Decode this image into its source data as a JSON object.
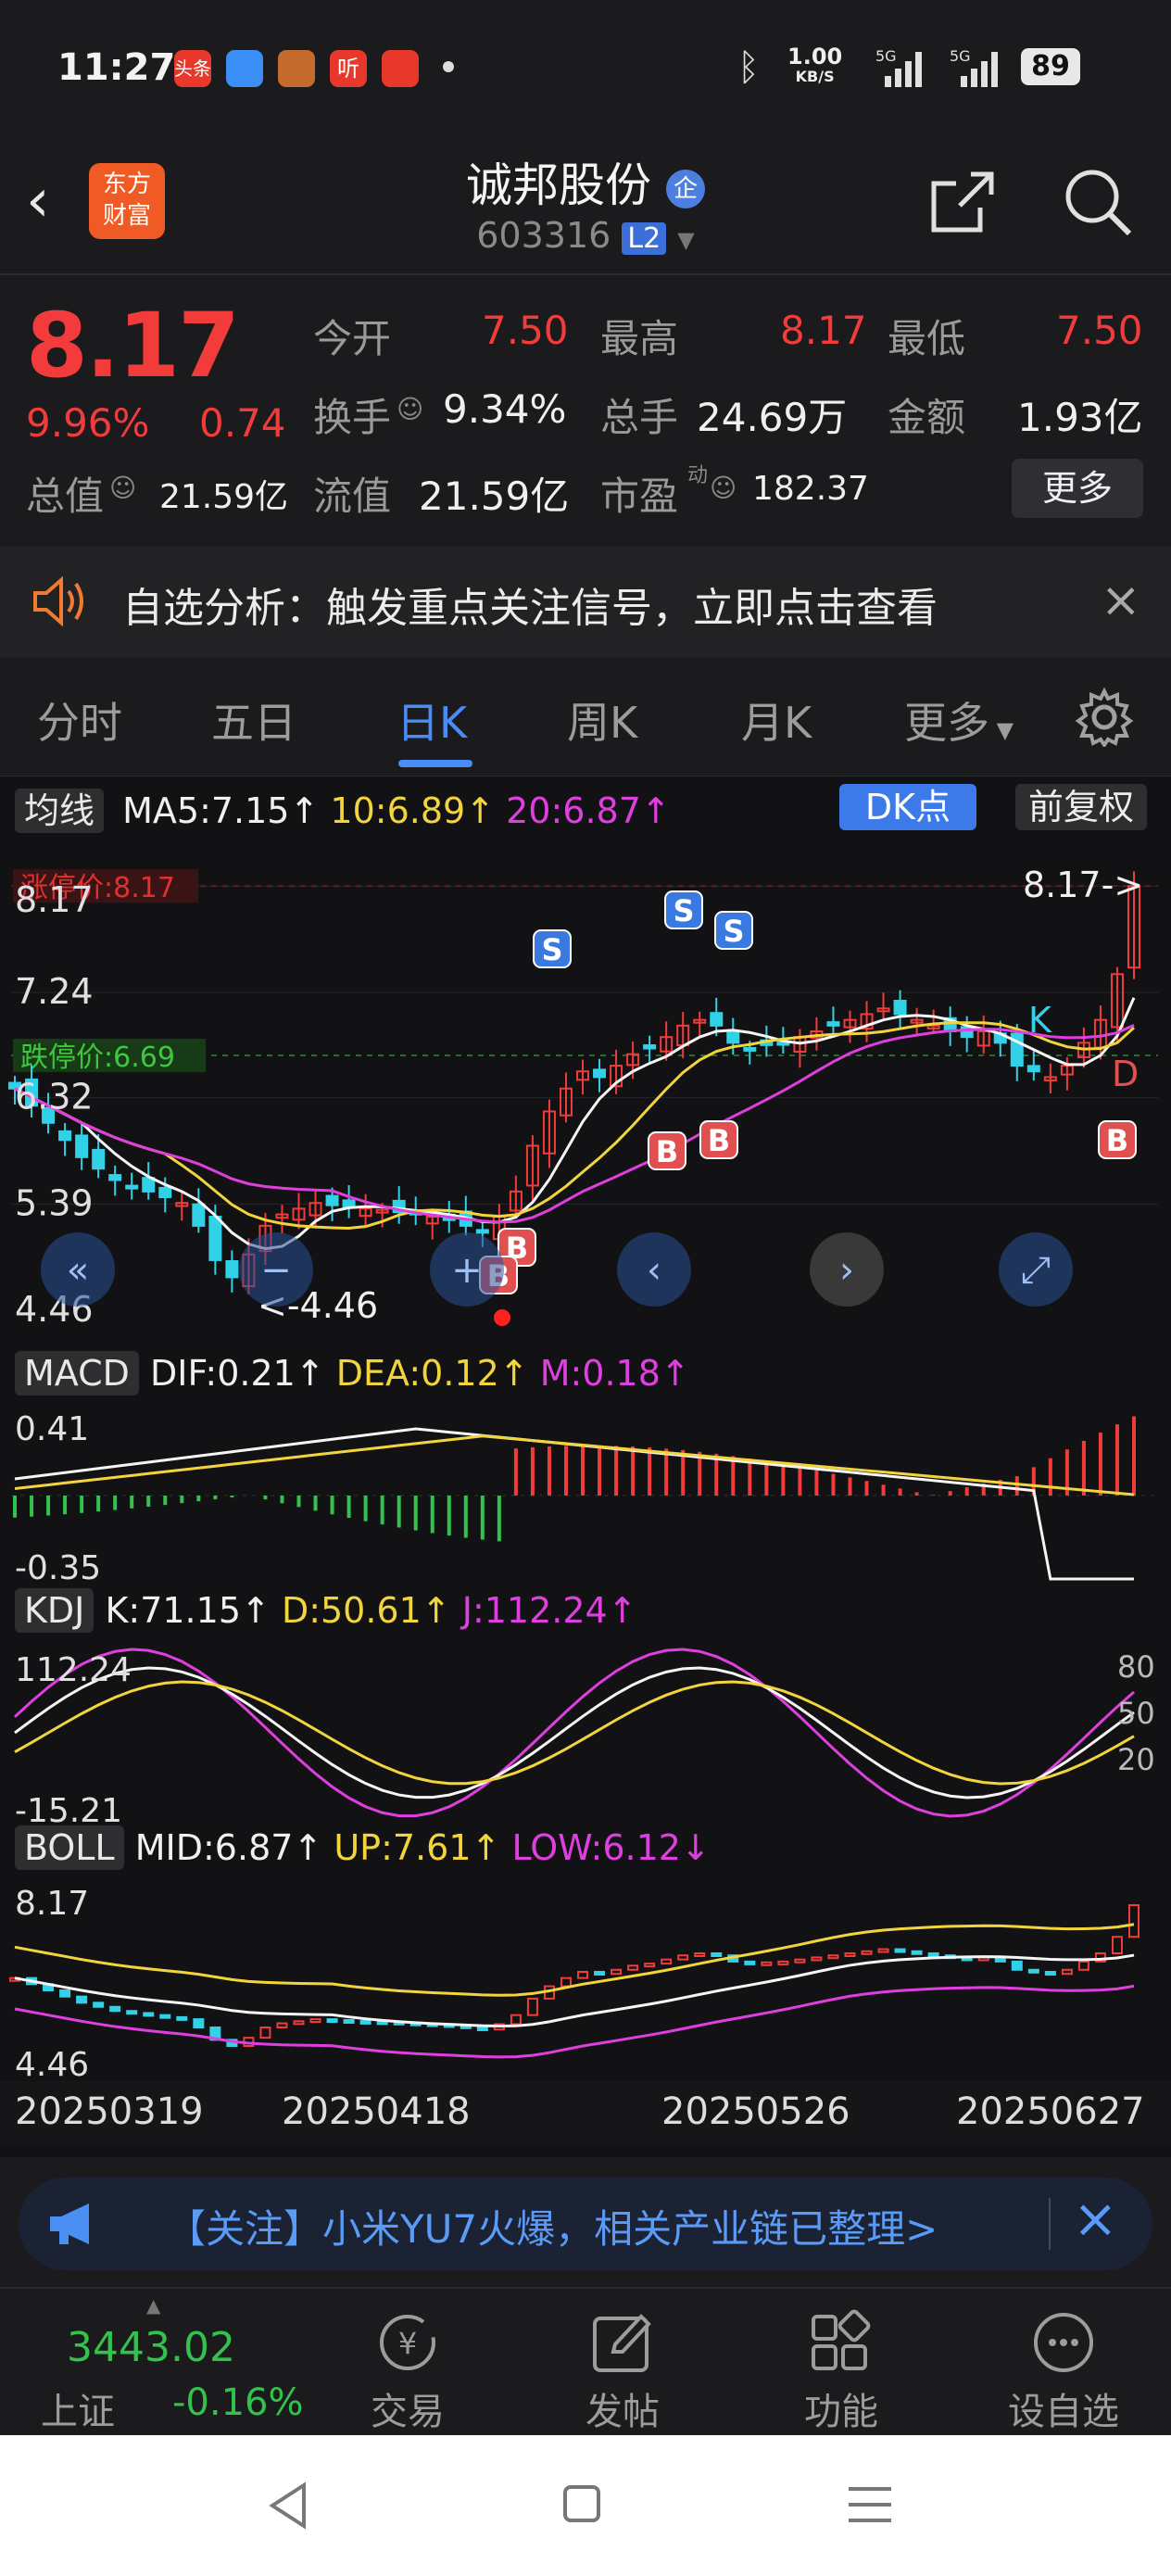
{
  "status_bar": {
    "time": "11:27",
    "net_speed_top": "1.00",
    "net_speed_unit": "KB/S",
    "battery": "89",
    "app_icons": [
      "头条",
      "weather",
      "game",
      "听",
      "health"
    ]
  },
  "header": {
    "stock_name": "诚邦股份",
    "badge": "企",
    "stock_code": "603316",
    "level": "L2",
    "logo_line1": "东方",
    "logo_line2": "财富"
  },
  "quote": {
    "price": "8.17",
    "change_pct": "9.96%",
    "change_amt": "0.74",
    "open_label": "今开",
    "open": "7.50",
    "high_label": "最高",
    "high": "8.17",
    "low_label": "最低",
    "low": "7.50",
    "turnover_label": "换手",
    "turnover": "9.34%",
    "volume_label": "总手",
    "volume": "24.69万",
    "amount_label": "金额",
    "amount": "1.93亿",
    "mktcap_label": "总值",
    "mktcap": "21.59亿",
    "float_label": "流值",
    "float": "21.59亿",
    "pe_label": "市盈",
    "pe_sup": "动",
    "pe": "182.37",
    "more_label": "更多"
  },
  "banner": {
    "text": "自选分析：触发重点关注信号，立即点击查看"
  },
  "tabs": [
    {
      "label": "分时",
      "active": false
    },
    {
      "label": "五日",
      "active": false
    },
    {
      "label": "日K",
      "active": true
    },
    {
      "label": "周K",
      "active": false
    },
    {
      "label": "月K",
      "active": false
    },
    {
      "label": "更多",
      "active": false
    }
  ],
  "chart": {
    "ma_button": "均线",
    "ma5": "MA5:7.15↑",
    "ma10": "10:6.89↑",
    "ma20": "20:6.87↑",
    "dk_button": "DK点",
    "adjust_button": "前复权",
    "limit_up_label": "涨停价:8.17",
    "limit_down_label": "跌停价:6.69",
    "y_ticks": [
      "8.17",
      "7.24",
      "6.32",
      "5.39",
      "4.46"
    ],
    "latest_marker": "8.17->",
    "low_marker": "<-4.46",
    "macd_button": "MACD",
    "macd_dif": "DIF:0.21↑",
    "macd_dea": "DEA:0.12↑",
    "macd_m": "M:0.18↑",
    "macd_ticks": [
      "0.41",
      "-0.35"
    ],
    "kdj_button": "KDJ",
    "kdj_k": "K:71.15↑",
    "kdj_d": "D:50.61↑",
    "kdj_j": "J:112.24↑",
    "kdj_ticks": [
      "112.24",
      "-15.21"
    ],
    "kdj_right_ticks": [
      "80",
      "50",
      "20"
    ],
    "boll_button": "BOLL",
    "boll_mid": "MID:6.87↑",
    "boll_up": "UP:7.61↑",
    "boll_low": "LOW:6.12↓",
    "boll_ticks": [
      "8.17",
      "4.46"
    ],
    "dates": [
      "20250319",
      "20250418",
      "20250526",
      "20250627"
    ],
    "signal_labels": [
      "S",
      "S",
      "S",
      "B",
      "B",
      "B",
      "B",
      "K",
      "D",
      "B"
    ]
  },
  "news": {
    "text": "【关注】小米YU7火爆，相关产业链已整理>"
  },
  "bottom_nav": {
    "index_value": "3443.02",
    "index_name": "上证",
    "index_change": "-0.16%",
    "items": [
      "交易",
      "发帖",
      "功能",
      "设自选"
    ]
  },
  "colors": {
    "up": "#f23b3b",
    "down": "#33c24d",
    "accent": "#3d7ff0",
    "ma5": "#f5f5f5",
    "ma10": "#f2d53c",
    "ma20": "#e03fe0",
    "bearish_candle": "#31d1e8"
  }
}
